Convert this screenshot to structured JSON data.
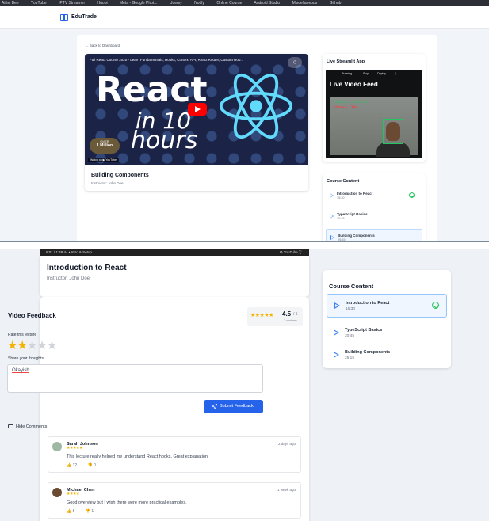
{
  "browser": {
    "bookmarks": [
      "Airtel Bee",
      "YouTube",
      "IPTV Streamer",
      "Huobi",
      "Meta - Google Phot...",
      "Udemy",
      "Notify",
      "Online Course",
      "Android Studio",
      "Miscellaneous",
      "Github"
    ]
  },
  "app": {
    "brand": "EduTrade"
  },
  "top": {
    "back_link": "← Back to Dashboard",
    "video": {
      "thumb_title": "Full React Course 2020 - Learn Fundamentals, Hooks, Context API, React Router, Custom Hoo...",
      "big_word": "React",
      "in_text": "in 10",
      "hours_text": "hours",
      "badge_top": "OVER",
      "badge_main": "1 Million",
      "watch_on": "Watch on ▶ YouTube",
      "lecture_title": "Building Components",
      "instructor": "Instructor: John Doe"
    },
    "stream": {
      "title": "Live Streamlit App",
      "bar_items": [
        "Running...",
        "Stop",
        "Deploy",
        "⋮"
      ],
      "heading": "Live Video Feed",
      "emotion_text": "Emotion: neutral",
      "stress_text": "Stress: 30%"
    },
    "course_content": {
      "title": "Course Content",
      "items": [
        {
          "name": "Introduction to React",
          "duration": "15:30",
          "completed": true
        },
        {
          "name": "TypeScript Basics",
          "duration": "20:45",
          "completed": false
        },
        {
          "name": "Building Components",
          "duration": "25:15",
          "completed": false,
          "active": true
        }
      ]
    }
  },
  "player": {
    "time": "6:01 / 1:48:44 • Intro & Setup",
    "controls": "⚙ YouTube ⛶"
  },
  "lecture": {
    "title": "Introduction to React",
    "instructor": "Instructor: John Doe"
  },
  "feedback": {
    "title": "Video Feedback",
    "avg_rating": "4.5",
    "out_of": "/ 5",
    "reviews": "2 reviews",
    "rating_stars": "★★★★★",
    "rate_label": "Rate this lecture",
    "user_rating": 2,
    "max_rating": 5,
    "thoughts_label": "Share your thoughts",
    "thoughts_value": "Okayish",
    "submit_label": "Submit Feedback",
    "hide_comments": "Hide Comments",
    "comments": [
      {
        "author": "Sarah Johnson",
        "stars": "★★★★★",
        "when": "2 days ago",
        "text": "This lecture really helped me understand React hooks. Great explanation!",
        "likes": "12",
        "dislikes": "0"
      },
      {
        "author": "Michael Chen",
        "stars": "★★★★",
        "when": "1 week ago",
        "text": "Good overview but I wish there were more practical examples.",
        "likes": "5",
        "dislikes": "1"
      }
    ]
  },
  "course_content": {
    "title": "Course Content",
    "items": [
      {
        "name": "Introduction to React",
        "duration": "15:30",
        "completed": true,
        "active": true
      },
      {
        "name": "TypeScript Basics",
        "duration": "20:45",
        "completed": false
      },
      {
        "name": "Building Components",
        "duration": "25:15",
        "completed": false
      }
    ]
  },
  "colors": {
    "accent": "#2563eb",
    "star": "#f5b301",
    "success": "#22c55e"
  }
}
